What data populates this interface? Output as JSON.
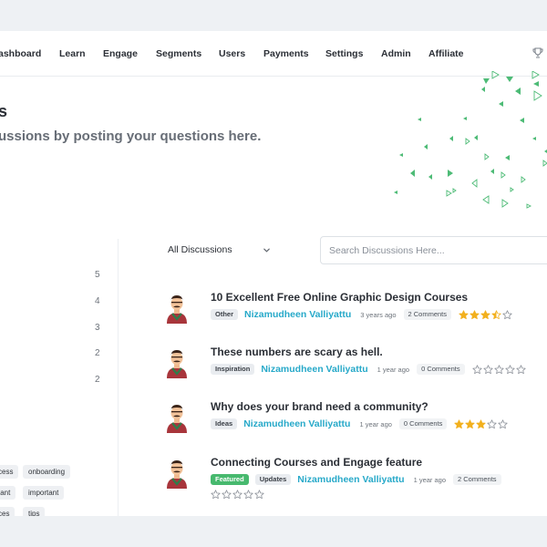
{
  "nav": {
    "items": [
      "ashboard",
      "Learn",
      "Engage",
      "Segments",
      "Users",
      "Payments",
      "Settings",
      "Admin",
      "Affiliate"
    ]
  },
  "hero": {
    "title": "s",
    "subtitle": "ussions by posting your questions here."
  },
  "sidebar": {
    "counts": [
      "5",
      "4",
      "3",
      "2",
      "2"
    ],
    "tags": [
      "cess",
      "onboarding",
      "tant",
      "important",
      "ces",
      "tips"
    ]
  },
  "filter": {
    "selected": "All Discussions"
  },
  "search": {
    "placeholder": "Search Discussions Here..."
  },
  "discussions": [
    {
      "title": "10 Excellent Free Online Graphic Design Courses",
      "category": "Other",
      "author": "Nizamudheen Valliyattu",
      "time_ago": "3 years ago",
      "comments": "2 Comments",
      "rating": 3.5
    },
    {
      "title": "These numbers are scary as hell.",
      "category": "Inspiration",
      "author": "Nizamudheen Valliyattu",
      "time_ago": "1 year ago",
      "comments": "0 Comments",
      "rating": 0
    },
    {
      "title": "Why does your brand need a community?",
      "category": "Ideas",
      "author": "Nizamudheen Valliyattu",
      "time_ago": "1 year ago",
      "comments": "0 Comments",
      "rating": 3
    },
    {
      "title": "Connecting Courses and Engage feature",
      "featured_label": "Featured",
      "category": "Updates",
      "author": "Nizamudheen Valliyattu",
      "time_ago": "1 year ago",
      "comments": "2 Comments",
      "rating": 0
    }
  ],
  "colors": {
    "accent_green": "#47b96e",
    "author_blue": "#27a9c9",
    "star_gold": "#f2b01e"
  }
}
